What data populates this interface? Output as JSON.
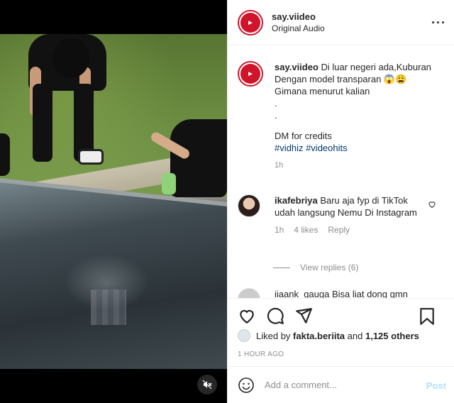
{
  "post": {
    "username": "say.viideo",
    "audio": "Original Audio",
    "avatar_text": "say viideo",
    "caption_lines": [
      "Di luar negeri ada,Kuburan Dengan model transparan 😱😩",
      "Gimana menurut kalian",
      ".",
      ".",
      "DM for credits"
    ],
    "hashtags": "#vidhiz #videohits",
    "caption_time": "1h"
  },
  "comment": {
    "username": "ikafebriya",
    "text": "Baru aja fyp di TikTok udah langsung Nemu Di Instagram",
    "time": "1h",
    "likes": "4 likes",
    "reply": "Reply",
    "view_replies": "View replies (6)"
  },
  "next_comment": {
    "text": "iiaank_gauga Bisa liat dong gmn"
  },
  "likes": {
    "prefix": "Liked by",
    "user": "fakta.beriita",
    "suffix": "and",
    "others": "1,125 others"
  },
  "timestamp": "1 HOUR AGO",
  "composer": {
    "placeholder": "Add a comment...",
    "post_label": "Post"
  },
  "icons": {
    "more": "more-icon",
    "heart": "heart-icon",
    "comment": "comment-icon",
    "share": "share-icon",
    "bookmark": "bookmark-icon",
    "emoji": "emoji-icon",
    "mute": "mute-icon"
  },
  "colors": {
    "brand": "#d0152a",
    "hashtag": "#00376b",
    "muted": "#8e8e8e",
    "post_disabled": "#b2dffc"
  }
}
